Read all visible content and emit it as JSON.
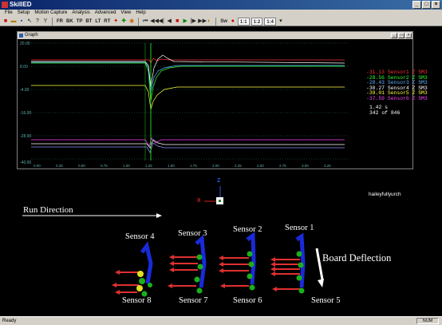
{
  "window": {
    "title": "SkillED"
  },
  "menu": [
    "File",
    "Setup",
    "Motion Capture",
    "Analysis",
    "Advanced",
    "View",
    "Help"
  ],
  "toolbar": {
    "view_buttons": [
      "FR",
      "BK",
      "TP",
      "BT",
      "LT",
      "RT"
    ],
    "zoom_buttons": [
      "1:1",
      "1:2",
      "1:4"
    ],
    "speed_label": "Sw"
  },
  "graph_window": {
    "title": "Graph",
    "y_tick_labels": [
      "20.00",
      "8.00",
      "-4.00",
      "-16.00",
      "-28.00",
      "-40.00"
    ],
    "x_tick_labels": [
      "0.00",
      "0.25",
      "0.50",
      "0.75",
      "1.00",
      "1.25",
      "1.50",
      "1.75",
      "2.00",
      "2.25",
      "2.50",
      "2.75",
      "3.00",
      "3.25"
    ],
    "legend": [
      {
        "value": "-31.13",
        "label": "Sensor1 Z SM3",
        "color": "#ff3030"
      },
      {
        "value": "-28.56",
        "label": "Sensor2 Z SM3",
        "color": "#30ff30"
      },
      {
        "value": "-28.43",
        "label": "Sensor3 Z SM3",
        "color": "#60b0ff"
      },
      {
        "value": "-30.27",
        "label": "Sensor4 Z SM3",
        "color": "#ffffff"
      },
      {
        "value": "-39.01",
        "label": "Sensor5 Z SM3",
        "color": "#ffff40"
      },
      {
        "value": "-37.59",
        "label": "Sensor6 Z SM3",
        "color": "#ff40ff"
      }
    ],
    "time_readout": "1.42 s",
    "frame_readout": "342 of 846",
    "filename": "haileyfullyurch"
  },
  "viewport": {
    "run_direction": "Run Direction",
    "board_deflection": "Board Deflection",
    "axis_z": "Z",
    "axis_x": "X",
    "sensors_top": [
      "Sensor 4",
      "Sensor 3",
      "Sensor 2",
      "Sensor 1"
    ],
    "sensors_bottom": [
      "Sensor 8",
      "Sensor 7",
      "Sensor 6",
      "Sensor 5"
    ]
  },
  "status": {
    "text": "Ready",
    "indicator": "NUM"
  }
}
